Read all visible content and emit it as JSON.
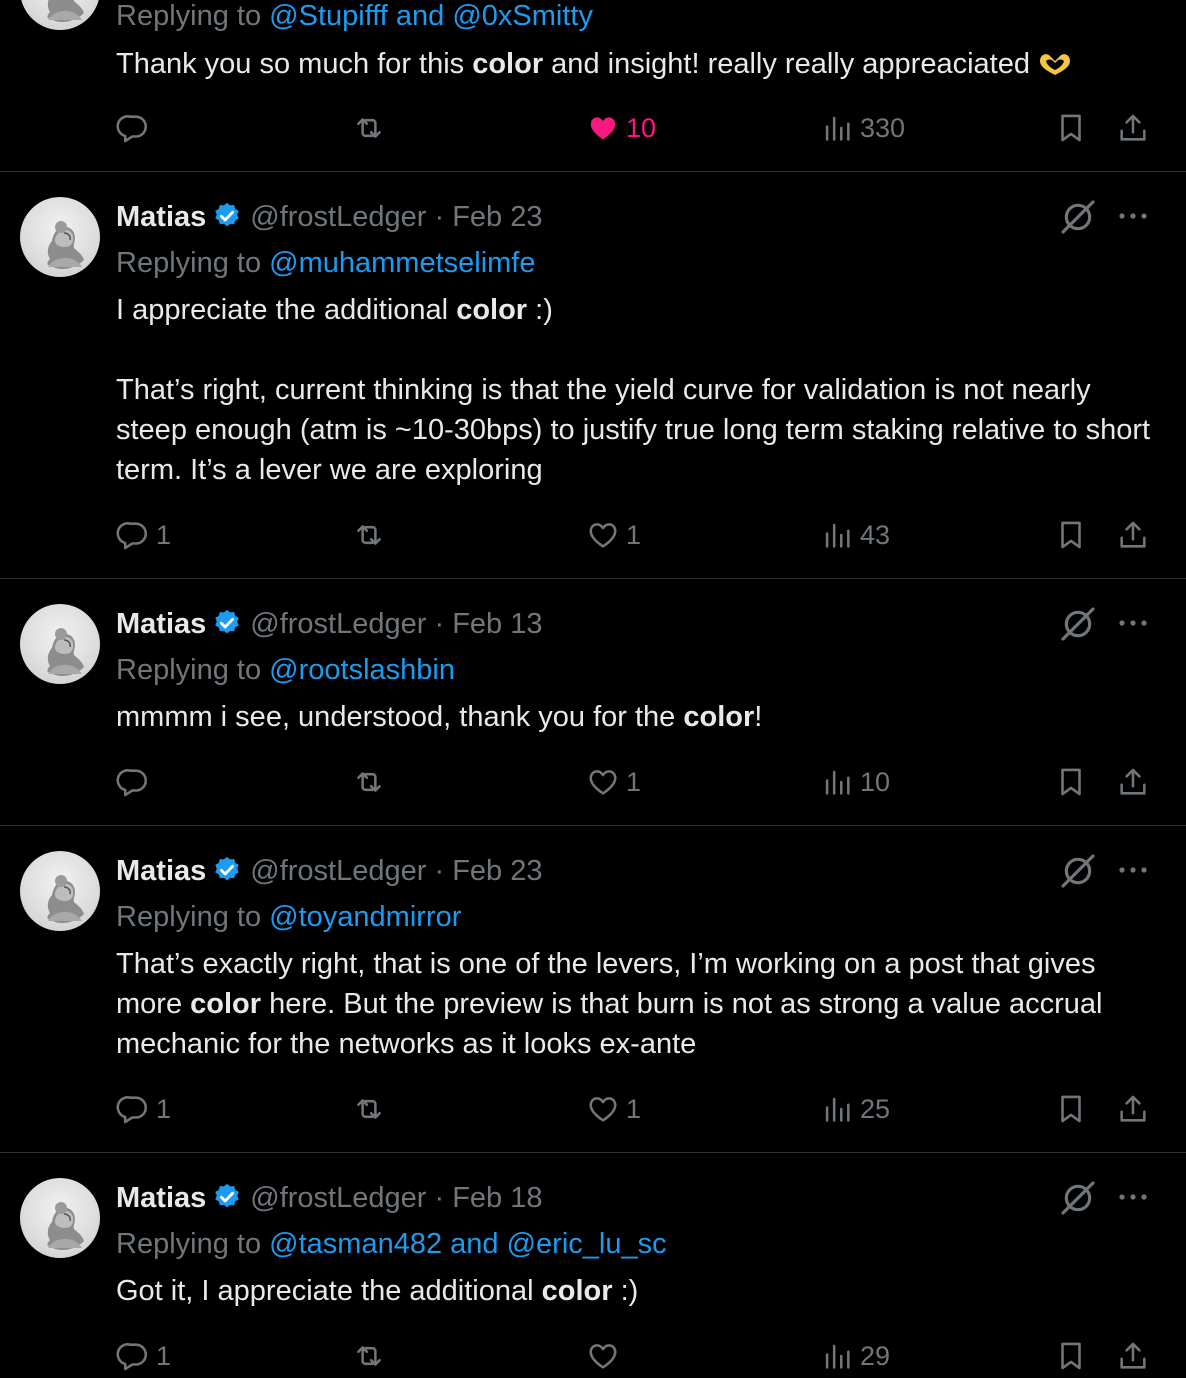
{
  "tweets": [
    {
      "reply_prefix": "Replying to",
      "mentions": [
        "@Stupifff",
        "@0xSmitty"
      ],
      "mention_joiner": "and",
      "text_parts": [
        "Thank you so much for this ",
        "color",
        " and insight! really really appreaciated"
      ],
      "emoji": "heart-hands",
      "replies": "",
      "likes": "10",
      "liked": true,
      "views": "330"
    },
    {
      "name": "Matias",
      "handle": "@frostLedger",
      "separator": "·",
      "date": "Feb 23",
      "reply_prefix": "Replying to",
      "mentions": [
        "@muhammetselimfe"
      ],
      "text_parts": [
        "I appreciate the additional ",
        "color",
        " :)"
      ],
      "text_para2": "That’s right, current thinking is that the yield curve for validation is not nearly steep enough (atm is ~10-30bps) to justify true long term staking relative to short term. It’s a lever we are exploring",
      "replies": "1",
      "likes": "1",
      "views": "43"
    },
    {
      "name": "Matias",
      "handle": "@frostLedger",
      "separator": "·",
      "date": "Feb 13",
      "reply_prefix": "Replying to",
      "mentions": [
        "@rootslashbin"
      ],
      "text_parts": [
        "mmmm i see, understood, thank you for the ",
        "color",
        "!"
      ],
      "replies": "",
      "likes": "1",
      "views": "10"
    },
    {
      "name": "Matias",
      "handle": "@frostLedger",
      "separator": "·",
      "date": "Feb 23",
      "reply_prefix": "Replying to",
      "mentions": [
        "@toyandmirror"
      ],
      "text_parts": [
        "That’s exactly right, that is one of the levers, I’m working on a post that gives more ",
        "color",
        " here. But the preview is that burn is not as strong a value accrual mechanic for the networks as it looks ex-ante"
      ],
      "replies": "1",
      "likes": "1",
      "views": "25"
    },
    {
      "name": "Matias",
      "handle": "@frostLedger",
      "separator": "·",
      "date": "Feb 18",
      "reply_prefix": "Replying to",
      "mentions": [
        "@tasman482",
        "@eric_lu_sc"
      ],
      "mention_joiner": "and",
      "text_parts": [
        "Got it, I appreciate the additional ",
        "color",
        " :)"
      ],
      "replies": "1",
      "likes": "",
      "views": "29"
    }
  ],
  "colors": {
    "background": "#000000",
    "text": "#e7e9ea",
    "muted": "#71767b",
    "link": "#1d9bf0",
    "like": "#f91880",
    "verified": "#1d9bf0",
    "divider": "#2f3336"
  },
  "icons": [
    "reply-icon",
    "retweet-icon",
    "like-icon",
    "views-icon",
    "bookmark-icon",
    "share-icon",
    "grok-icon",
    "more-icon",
    "verified-badge-icon"
  ]
}
